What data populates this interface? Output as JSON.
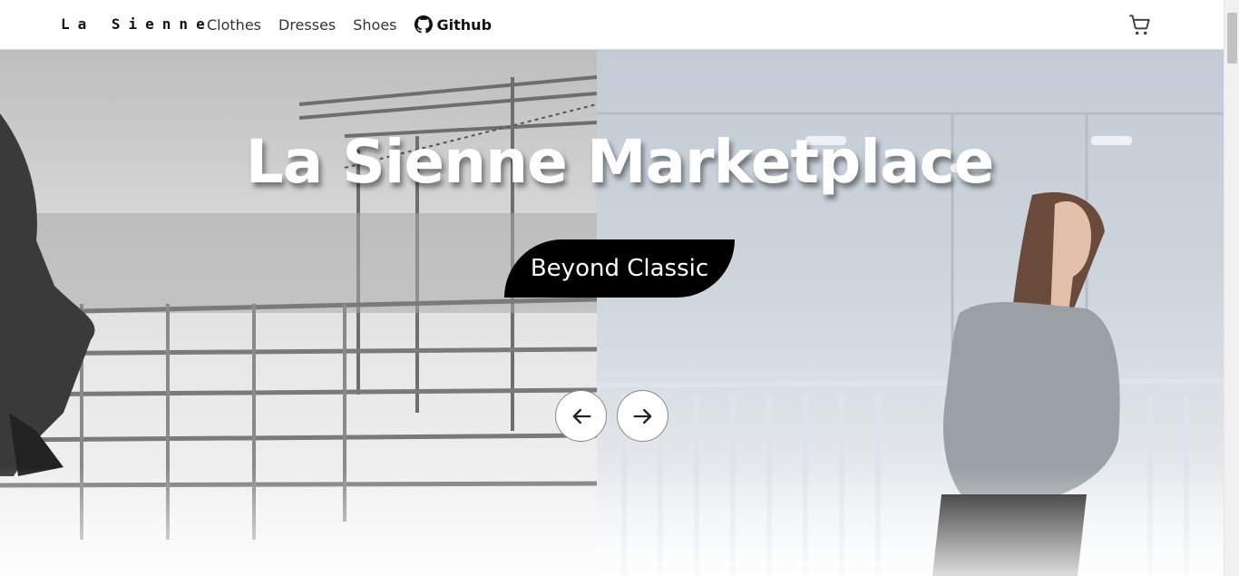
{
  "header": {
    "brand": "La Sienne",
    "nav": [
      {
        "label": "Clothes"
      },
      {
        "label": "Dresses"
      },
      {
        "label": "Shoes"
      }
    ],
    "github_label": "Github",
    "icons": {
      "github": "github-icon",
      "cart": "shopping-cart-icon"
    }
  },
  "hero": {
    "title": "La Sienne Marketplace",
    "tagline": "Beyond Classic",
    "controls": {
      "prev": "arrow-left-icon",
      "next": "arrow-right-icon"
    }
  },
  "colors": {
    "header_bg": "#ffffff",
    "tagline_bg": "#000000",
    "text_dark": "#111111"
  }
}
